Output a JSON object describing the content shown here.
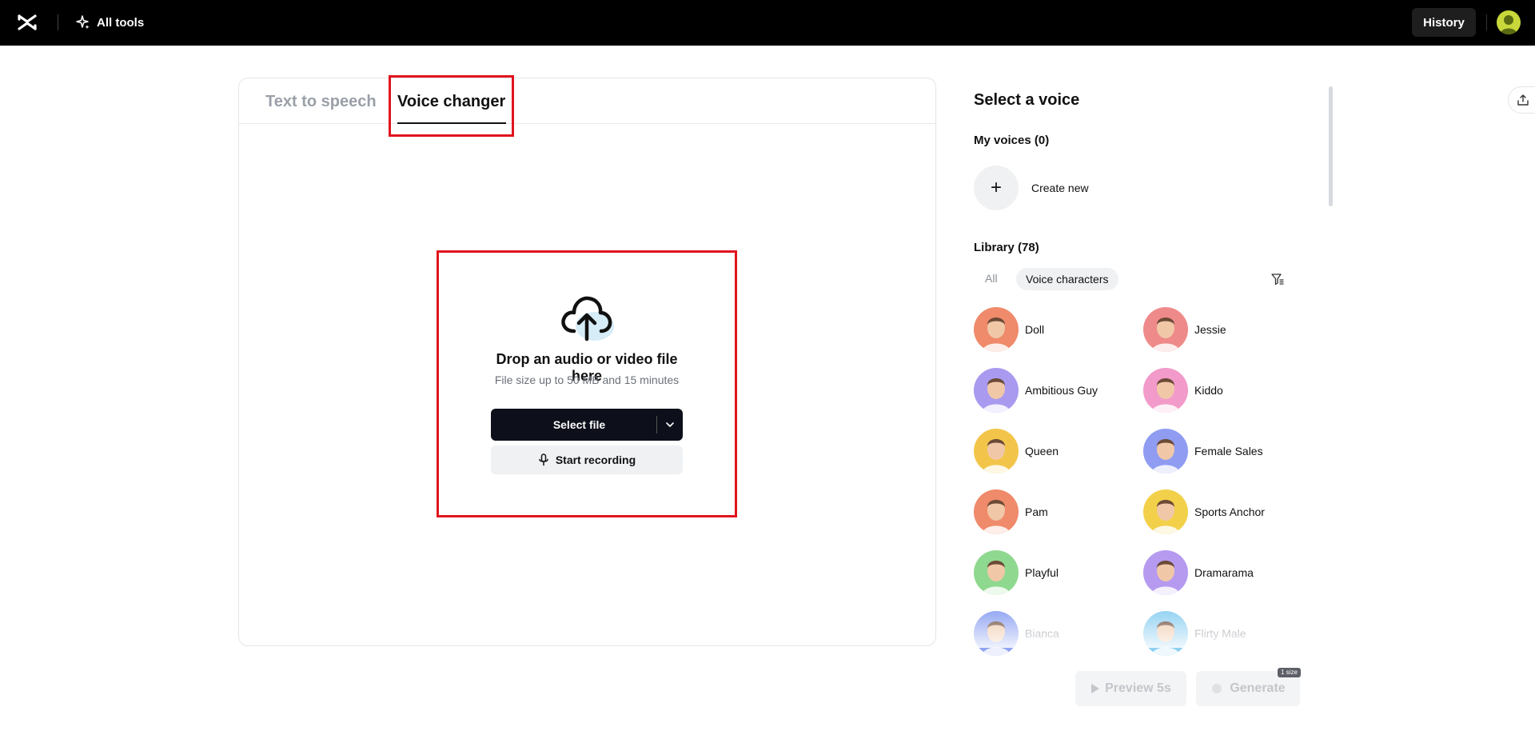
{
  "topbar": {
    "all_tools_label": "All tools",
    "history_label": "History"
  },
  "tabs": [
    {
      "label": "Text to speech",
      "active": false
    },
    {
      "label": "Voice changer",
      "active": true
    }
  ],
  "drop": {
    "title": "Drop an audio or video file here",
    "subtitle": "File size up to 50 MB and 15 minutes",
    "select_label": "Select file",
    "record_label": "Start recording"
  },
  "panel": {
    "title": "Select a voice",
    "my_voices": "My voices (0)",
    "create_new": "Create new",
    "library": "Library (78)",
    "filter_all": "All",
    "filter_active": "Voice characters"
  },
  "voices": [
    {
      "name": "Doll",
      "color": "#ef8a6a"
    },
    {
      "name": "Jessie",
      "color": "#ef8a8a"
    },
    {
      "name": "Ambitious Guy",
      "color": "#a99af0"
    },
    {
      "name": "Kiddo",
      "color": "#f29ac9"
    },
    {
      "name": "Queen",
      "color": "#f2c54a"
    },
    {
      "name": "Female Sales",
      "color": "#8f9cf2"
    },
    {
      "name": "Pam",
      "color": "#ef8a6a"
    },
    {
      "name": "Sports Anchor",
      "color": "#f2d04a"
    },
    {
      "name": "Playful",
      "color": "#8fd88f"
    },
    {
      "name": "Dramarama",
      "color": "#b59af0"
    },
    {
      "name": "Bianca",
      "color": "#8fa3f2"
    },
    {
      "name": "Flirty Male",
      "color": "#8fd0f2"
    }
  ],
  "actions": {
    "preview_label": "Preview 5s",
    "generate_label": "Generate",
    "generate_badge": "1 size"
  },
  "colors": {
    "highlight": "#e1141e",
    "topbar": "#000000",
    "primary_button": "#0d0f1a"
  }
}
